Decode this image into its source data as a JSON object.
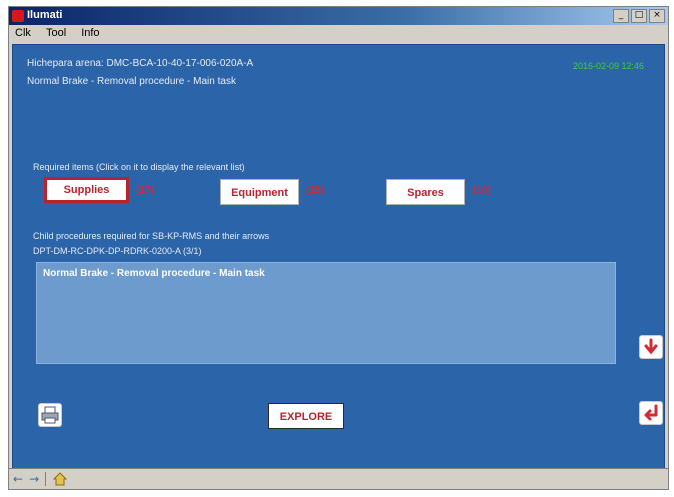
{
  "window": {
    "title": "Ilumati",
    "controls": [
      "_",
      "□",
      "×"
    ]
  },
  "menu": {
    "items": [
      "Clk",
      "Tool",
      "Info"
    ]
  },
  "header": {
    "line1": "Hichepara arena: DMC-BCA-10-40-17-006-020A-A",
    "line2": "Normal Brake - Removal procedure - Main task",
    "datetime": "2016-02-09 12:46"
  },
  "requirements": {
    "prompt": "Required items (Click on it to display the relevant list)",
    "buttons": [
      {
        "label": "Supplies",
        "count": "(17)",
        "selected": true
      },
      {
        "label": "Equipment",
        "count": "(18)",
        "selected": false
      },
      {
        "label": "Spares",
        "count": "(10)",
        "selected": false
      }
    ]
  },
  "procedures": {
    "line1": "Child procedures required for SB-KP-RMS and their arrows",
    "line2": "DPT-DM-RC-DPK-DP-RDRK-0200-A (3/1)",
    "items": [
      "Normal Brake - Removal procedure - Main task"
    ]
  },
  "actions": {
    "explore_label": "EXPLORE"
  },
  "icons": {
    "down": "arrow-down-icon",
    "enter": "enter-return-icon",
    "print": "printer-icon",
    "back": "back-arrow-icon",
    "forward": "forward-arrow-icon",
    "home": "home-icon"
  },
  "colors": {
    "background": "#2b64a9",
    "accent": "#b8232d",
    "list": "#6d9bcd",
    "datetime": "#38d038"
  }
}
